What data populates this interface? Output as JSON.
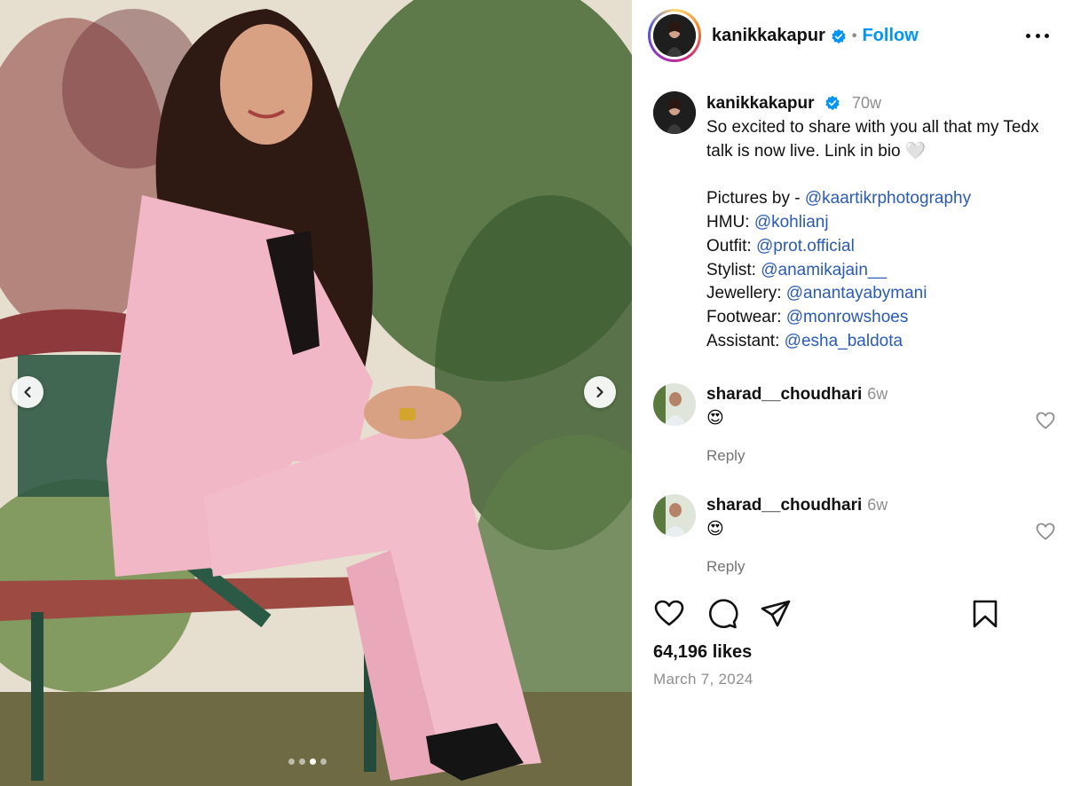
{
  "post": {
    "username": "kanikkakapur",
    "follow_label": "Follow",
    "separator": "•",
    "caption": {
      "time": "70w",
      "text": "So excited to share with you all that my Tedx talk is now live. Link in bio 🤍",
      "credits": [
        {
          "label": "Pictures by - ",
          "handle": "@kaartikrphotography"
        },
        {
          "label": "HMU: ",
          "handle": "@kohlianj"
        },
        {
          "label": "Outfit: ",
          "handle": "@prot.official"
        },
        {
          "label": "Stylist: ",
          "handle": "@anamikajain__"
        },
        {
          "label": "Jewellery: ",
          "handle": "@anantayabymani"
        },
        {
          "label": "Footwear: ",
          "handle": "@monrowshoes"
        },
        {
          "label": "Assistant: ",
          "handle": "@esha_baldota"
        }
      ]
    },
    "comments": [
      {
        "username": "sharad__choudhari",
        "time": "6w",
        "text": "😍",
        "reply_label": "Reply"
      },
      {
        "username": "sharad__choudhari",
        "time": "6w",
        "text": "😍",
        "reply_label": "Reply"
      }
    ],
    "likes": "64,196 likes",
    "date": "March 7, 2024",
    "carousel": {
      "total_slides": 4,
      "active_slide": 3
    }
  },
  "colors": {
    "accent": "#0095f6",
    "mention": "#2b5bb5",
    "verified": "#0095f6",
    "suit": "#f2b7c6"
  },
  "icons": {
    "verified": "verified-badge-icon",
    "more": "more-options-icon",
    "prev": "chevron-left-icon",
    "next": "chevron-right-icon",
    "like": "heart-icon",
    "comment": "comment-icon",
    "share": "share-icon",
    "save": "bookmark-icon"
  }
}
